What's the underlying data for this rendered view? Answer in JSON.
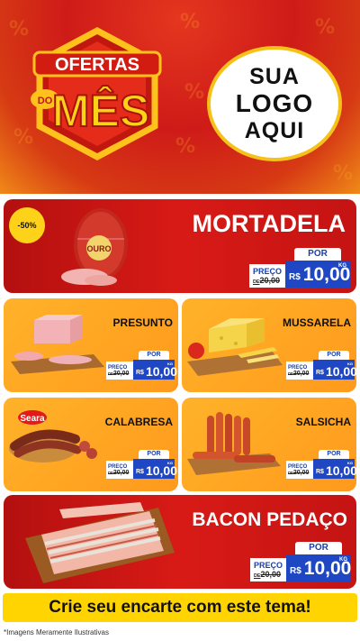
{
  "header": {
    "badge_line1": "OFERTAS",
    "badge_do": "DO",
    "badge_line2": "MÊS",
    "logo_lines": [
      "SUA",
      "LOGO",
      "AQUI"
    ]
  },
  "products": {
    "mortadela": {
      "name": "MORTADELA",
      "badge": "-50%",
      "brand": "OURO",
      "por": "POR",
      "preco": "PREÇO",
      "de": "DE",
      "old": "20,00",
      "currency": "R$",
      "value": "10,00",
      "unit": "KG"
    },
    "presunto": {
      "name": "PRESUNTO",
      "por": "POR",
      "preco": "PREÇO",
      "de": "DE",
      "old": "20,00",
      "currency": "R$",
      "value": "10,00",
      "unit": "KG"
    },
    "mussarela": {
      "name": "MUSSARELA",
      "por": "POR",
      "preco": "PREÇO",
      "de": "DE",
      "old": "20,00",
      "currency": "R$",
      "value": "10,00",
      "unit": "KG"
    },
    "calabresa": {
      "name": "CALABRESA",
      "brand": "Seara",
      "por": "POR",
      "preco": "PREÇO",
      "de": "DE",
      "old": "20,00",
      "currency": "R$",
      "value": "10,00",
      "unit": "KG"
    },
    "salsicha": {
      "name": "SALSICHA",
      "por": "POR",
      "preco": "PREÇO",
      "de": "DE",
      "old": "20,00",
      "currency": "R$",
      "value": "10,00",
      "unit": "KG"
    },
    "bacon": {
      "name": "BACON PEDAÇO",
      "por": "POR",
      "preco": "PREÇO",
      "de": "DE",
      "old": "20,00",
      "currency": "R$",
      "value": "10,00",
      "unit": "KG"
    }
  },
  "footer": {
    "cta": "Crie seu encarte com este tema!",
    "note": "*Imagens Meramente Ilustrativas"
  },
  "colors": {
    "red": "#d81a16",
    "orange": "#ffa322",
    "yellow": "#ffd400",
    "blue": "#1f47c4"
  }
}
